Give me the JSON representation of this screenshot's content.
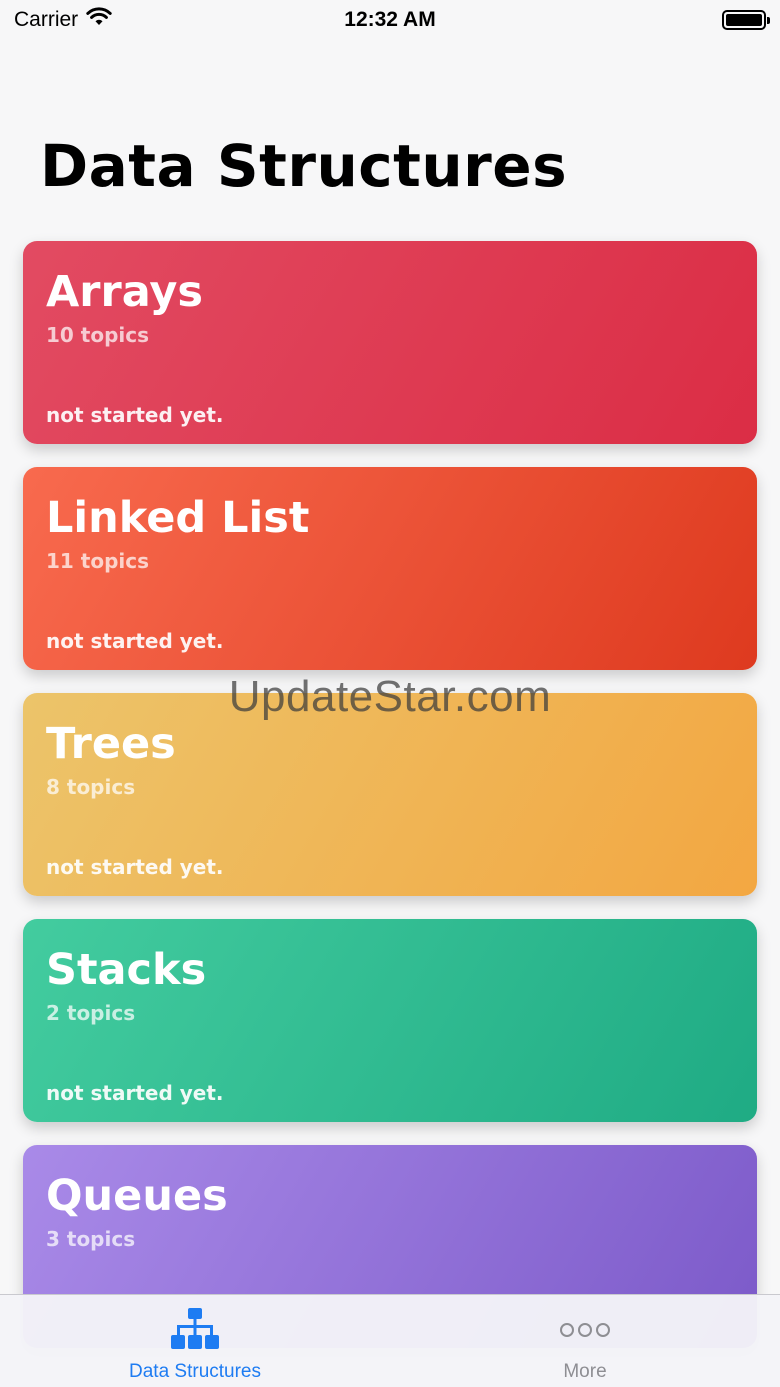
{
  "status_bar": {
    "carrier": "Carrier",
    "time": "12:32 AM",
    "battery_level": 1.0
  },
  "header": {
    "title": "Data Structures"
  },
  "cards": [
    {
      "title": "Arrays",
      "topics": "10 topics",
      "status": "not started yet."
    },
    {
      "title": "Linked List",
      "topics": "11 topics",
      "status": "not started yet."
    },
    {
      "title": "Trees",
      "topics": "8 topics",
      "status": "not started yet."
    },
    {
      "title": "Stacks",
      "topics": "2 topics",
      "status": "not started yet."
    },
    {
      "title": "Queues",
      "topics": "3 topics",
      "status": ""
    }
  ],
  "watermark": "UpdateStar.com",
  "tab_bar": {
    "tabs": [
      {
        "label": "Data Structures",
        "icon": "hierarchy-icon",
        "active": true
      },
      {
        "label": "More",
        "icon": "more-dots-icon",
        "active": false
      }
    ],
    "active_color": "#1e7cf2",
    "inactive_color": "#8e8e93"
  }
}
